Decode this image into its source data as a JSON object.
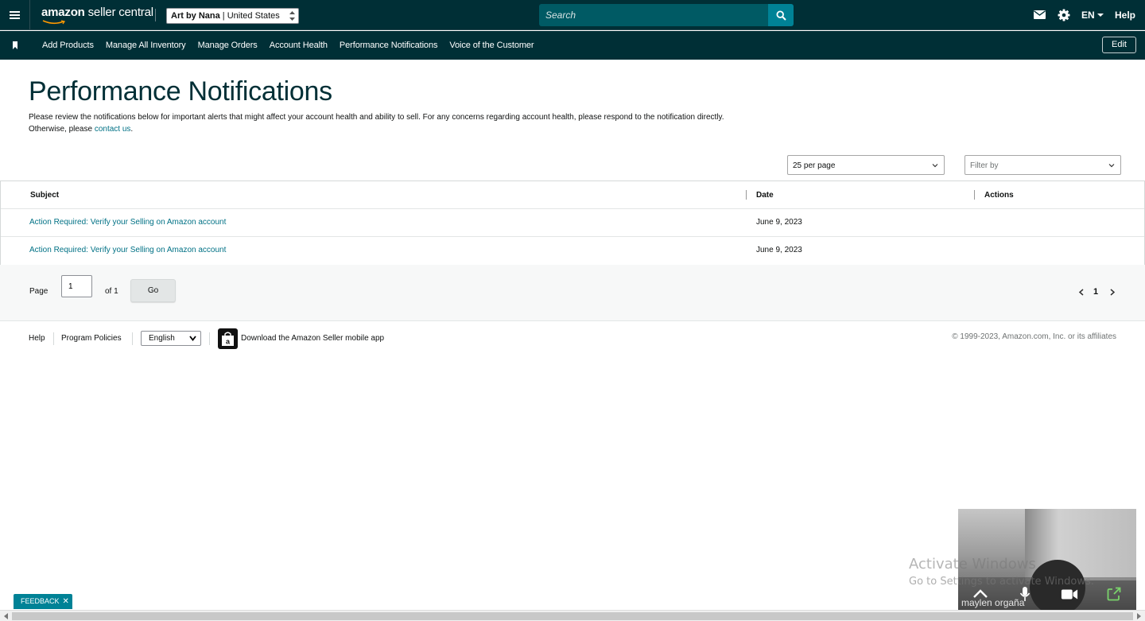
{
  "header": {
    "logo_brand": "amazon",
    "logo_product": "seller central",
    "account_name": "Art by Nana",
    "account_region": "United States",
    "search_placeholder": "Search",
    "language": "EN",
    "help_label": "Help"
  },
  "nav": {
    "items": [
      {
        "label": "Add Products"
      },
      {
        "label": "Manage All Inventory"
      },
      {
        "label": "Manage Orders"
      },
      {
        "label": "Account Health"
      },
      {
        "label": "Performance Notifications"
      },
      {
        "label": "Voice of the Customer"
      }
    ],
    "edit_label": "Edit"
  },
  "page": {
    "title": "Performance Notifications",
    "description": "Please review the notifications below for important alerts that might affect your account health and ability to sell. For any concerns regarding account health, please respond to the notification directly.",
    "description_line2_prefix": "Otherwise, please",
    "contact_link": "contact us",
    "description_line2_suffix": "."
  },
  "controls": {
    "per_page": "25 per page",
    "filter_placeholder": "Filter by"
  },
  "table": {
    "columns": [
      "Subject",
      "Date",
      "Actions"
    ],
    "rows": [
      {
        "subject": "Action Required: Verify your Selling on Amazon account",
        "date": "June 9, 2023",
        "actions": ""
      },
      {
        "subject": "Action Required: Verify your Selling on Amazon account",
        "date": "June 9, 2023",
        "actions": ""
      }
    ]
  },
  "pagination": {
    "page_label": "Page",
    "current_page": "1",
    "of_label": "of 1",
    "go_label": "Go",
    "page_number": "1"
  },
  "footer": {
    "help": "Help",
    "program_policies": "Program Policies",
    "language_selected": "English",
    "app_download": "Download the Amazon Seller mobile app",
    "copyright": "© 1999-2023, Amazon.com, Inc. or its affiliates"
  },
  "overlays": {
    "watermark_title": "Activate Windows",
    "watermark_sub": "Go to Settings to activate Windows.",
    "video_name": "maylen orgaña",
    "feedback_label": "FEEDBACK"
  },
  "colors": {
    "header_bg": "#002f36",
    "search_bg": "#005a64",
    "accent": "#008296",
    "link": "#007185"
  }
}
